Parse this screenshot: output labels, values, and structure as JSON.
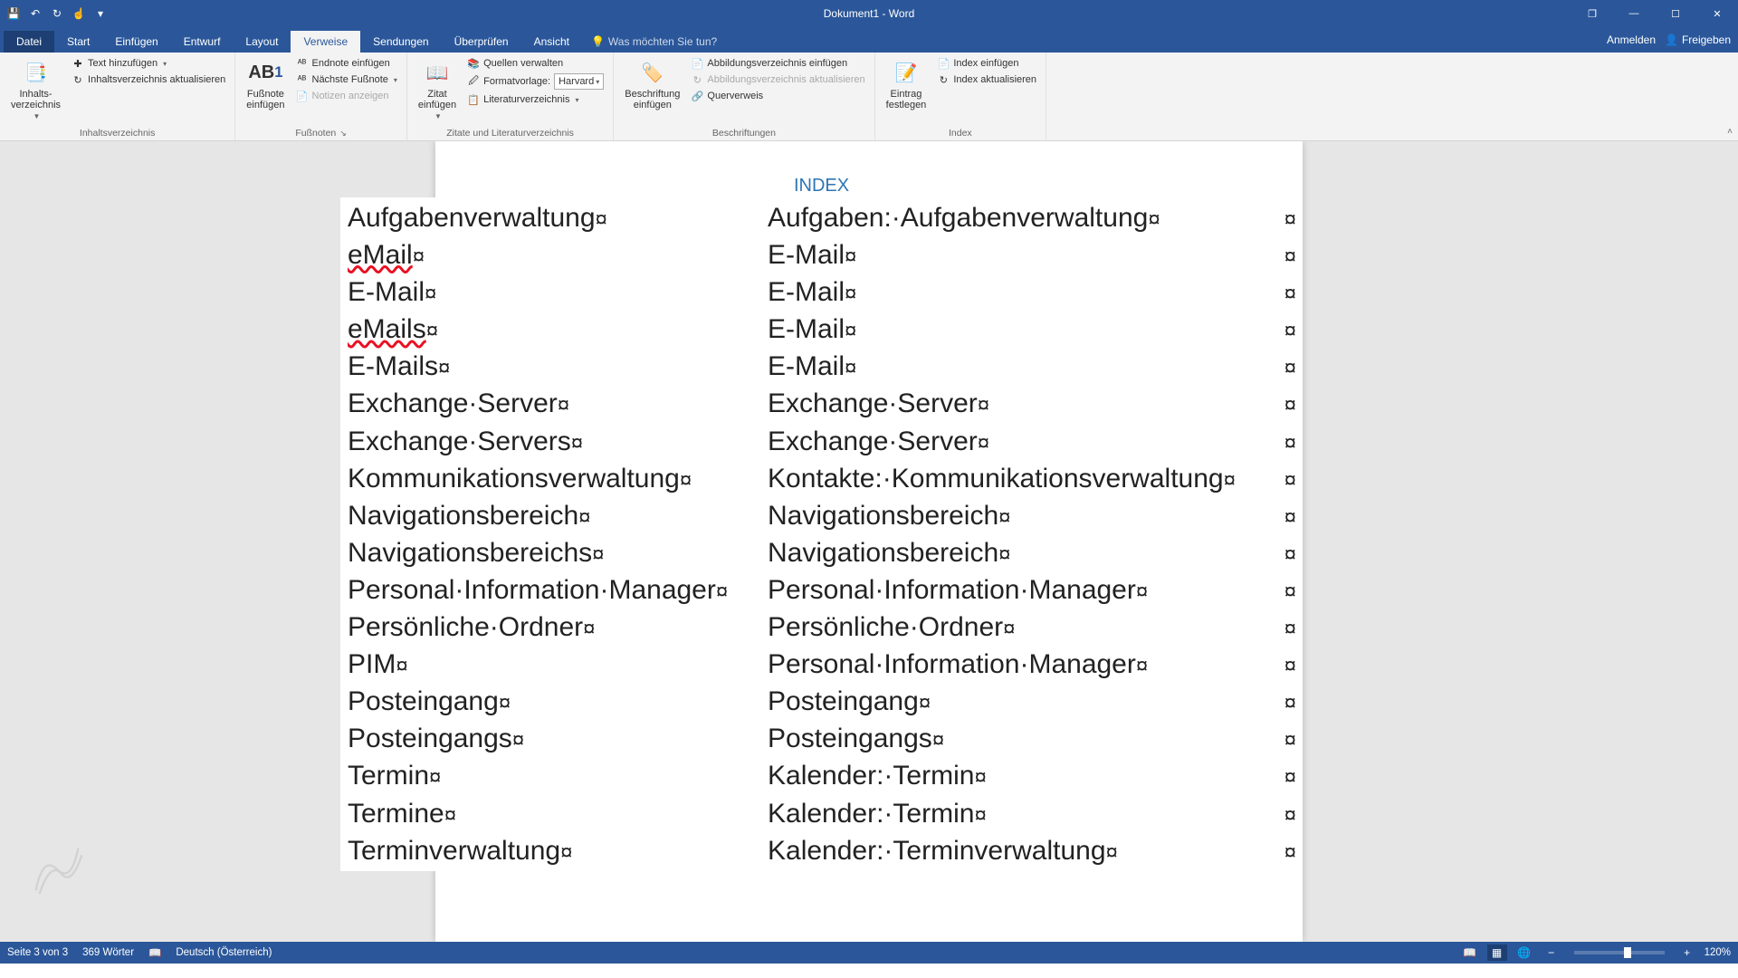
{
  "title": "Dokument1 - Word",
  "qat": {
    "save": "💾",
    "undo": "↶",
    "redo": "↻",
    "touch": "☝"
  },
  "window": {
    "restore": "❐",
    "min": "—",
    "max": "☐",
    "close": "✕"
  },
  "tabs": {
    "file": "Datei",
    "start": "Start",
    "einfuegen": "Einfügen",
    "entwurf": "Entwurf",
    "layout": "Layout",
    "verweise": "Verweise",
    "sendungen": "Sendungen",
    "ueberpruefen": "Überprüfen",
    "ansicht": "Ansicht",
    "tellme": "Was möchten Sie tun?",
    "anmelden": "Anmelden",
    "freigeben": "Freigeben"
  },
  "ribbon": {
    "toc": {
      "big": "Inhalts-\nverzeichnis",
      "addtext": "Text hinzufügen",
      "update": "Inhaltsverzeichnis aktualisieren",
      "label": "Inhaltsverzeichnis"
    },
    "footnotes": {
      "big": "Fußnote\neinfügen",
      "endnote": "Endnote einfügen",
      "next": "Nächste Fußnote",
      "show": "Notizen anzeigen",
      "label": "Fußnoten",
      "ab": "AB"
    },
    "citations": {
      "big": "Zitat\neinfügen",
      "manage": "Quellen verwalten",
      "style": "Formatvorlage:",
      "style_val": "Harvard",
      "biblio": "Literaturverzeichnis",
      "label": "Zitate und Literaturverzeichnis"
    },
    "captions": {
      "big": "Beschriftung\neinfügen",
      "figlist": "Abbildungsverzeichnis einfügen",
      "figupdate": "Abbildungsverzeichnis aktualisieren",
      "crossref": "Querverweis",
      "label": "Beschriftungen"
    },
    "index": {
      "big": "Eintrag\nfestlegen",
      "insert": "Index einfügen",
      "update": "Index aktualisieren",
      "label": "Index"
    }
  },
  "indexHeading": "INDEX",
  "rows": [
    {
      "a": "Aufgabenverwaltung",
      "b": "Aufgaben:·Aufgabenverwaltung",
      "aerr": false
    },
    {
      "a": "eMail",
      "b": "E-Mail",
      "aerr": true
    },
    {
      "a": "E-Mail",
      "b": "E-Mail",
      "aerr": false
    },
    {
      "a": "eMails",
      "b": "E-Mail",
      "aerr": true
    },
    {
      "a": "E-Mails",
      "b": "E-Mail",
      "aerr": false
    },
    {
      "a": "Exchange·Server",
      "b": "Exchange·Server",
      "aerr": false
    },
    {
      "a": "Exchange·Servers",
      "b": "Exchange·Server",
      "aerr": false
    },
    {
      "a": "Kommunikationsverwaltung",
      "b": "Kontakte:·Kommunikationsverwaltung",
      "aerr": false
    },
    {
      "a": "Navigationsbereich",
      "b": "Navigationsbereich",
      "aerr": false
    },
    {
      "a": "Navigationsbereichs",
      "b": "Navigationsbereich",
      "aerr": false
    },
    {
      "a": "Personal·Information·Manager",
      "b": "Personal·Information·Manager",
      "aerr": false
    },
    {
      "a": "Persönliche·Ordner",
      "b": "Persönliche·Ordner",
      "aerr": false
    },
    {
      "a": "PIM",
      "b": "Personal·Information·Manager",
      "aerr": false
    },
    {
      "a": "Posteingang",
      "b": "Posteingang",
      "aerr": false
    },
    {
      "a": "Posteingangs",
      "b": "Posteingangs",
      "aerr": false
    },
    {
      "a": "Termin",
      "b": "Kalender:·Termin",
      "aerr": false
    },
    {
      "a": "Termine",
      "b": "Kalender:·Termin",
      "aerr": false
    },
    {
      "a": "Terminverwaltung",
      "b": "Kalender:·Terminverwaltung",
      "aerr": false
    }
  ],
  "mark": "¤",
  "status": {
    "page": "Seite 3 von 3",
    "words": "369 Wörter",
    "lang": "Deutsch (Österreich)",
    "zoom": "120%"
  }
}
